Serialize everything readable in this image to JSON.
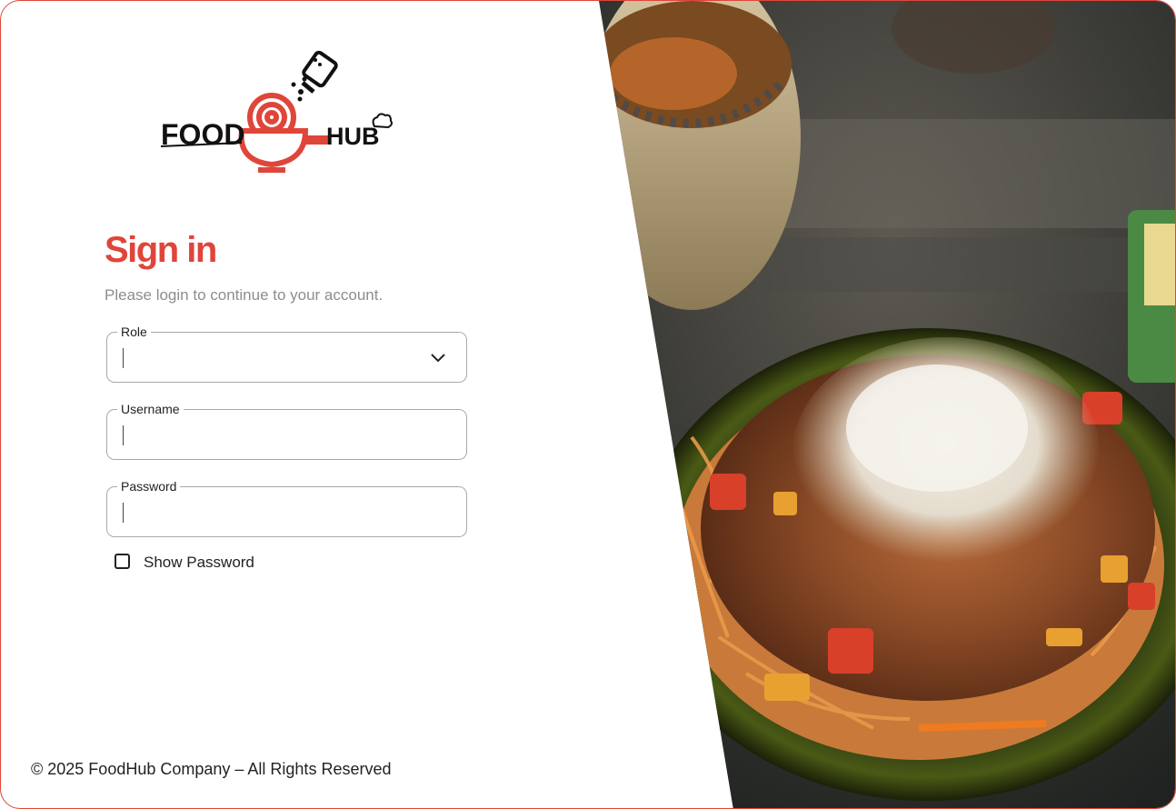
{
  "brand": {
    "logo_left": "FOOD",
    "logo_right": "HUB",
    "accent_color": "#e0453a"
  },
  "login": {
    "title": "Sign in",
    "subtitle": "Please login to continue to your account."
  },
  "fields": {
    "role": {
      "label": "Role",
      "value": ""
    },
    "username": {
      "label": "Username",
      "value": ""
    },
    "password": {
      "label": "Password",
      "value": ""
    }
  },
  "show_password": {
    "label": "Show Password",
    "checked": false
  },
  "footer": {
    "text": "© 2025 FoodHub Company – All Rights Reserved"
  },
  "icons": {
    "dropdown": "chevron-down-icon",
    "photo": "spaghetti-bolognese-photo"
  }
}
